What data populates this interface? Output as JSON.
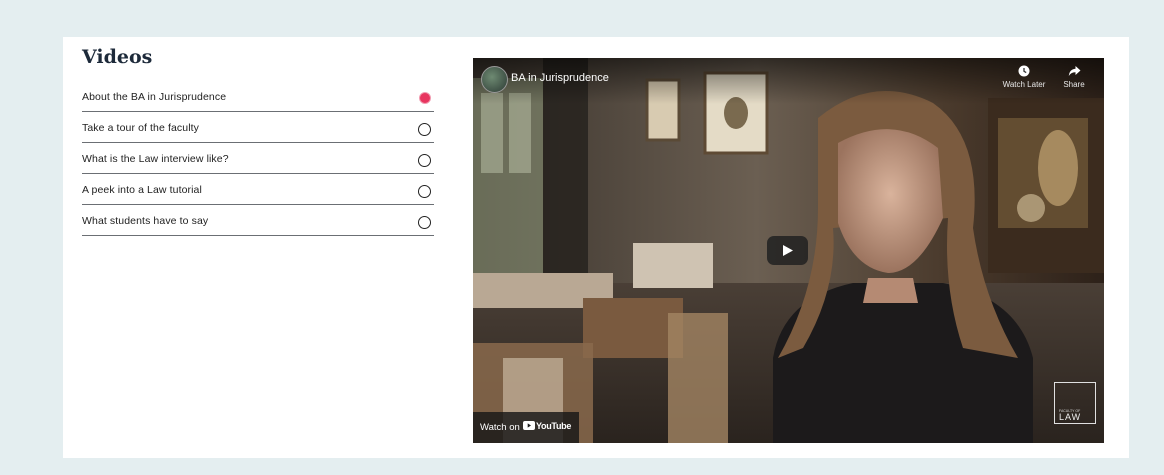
{
  "section": {
    "heading": "Videos"
  },
  "videos": [
    {
      "label": "About the BA in Jurisprudence",
      "selected": true
    },
    {
      "label": "Take a tour of the faculty",
      "selected": false
    },
    {
      "label": "What is the Law interview like?",
      "selected": false
    },
    {
      "label": "A peek into a Law tutorial",
      "selected": false
    },
    {
      "label": "What students have to say",
      "selected": false
    }
  ],
  "player": {
    "title": "BA in Jurisprudence",
    "watch_later_label": "Watch Later",
    "share_label": "Share",
    "watch_on_label": "Watch on",
    "youtube_wordmark": "YouTube",
    "badge_small": "FACULTY OF",
    "badge_big": "LAW"
  },
  "colors": {
    "page_background": "#e4eef0",
    "active_radio": "#e8355f",
    "heading": "#1d2a3a"
  },
  "icons": [
    "clock-icon",
    "share-arrow-icon",
    "play-icon",
    "youtube-logo-icon",
    "radio-icon"
  ]
}
